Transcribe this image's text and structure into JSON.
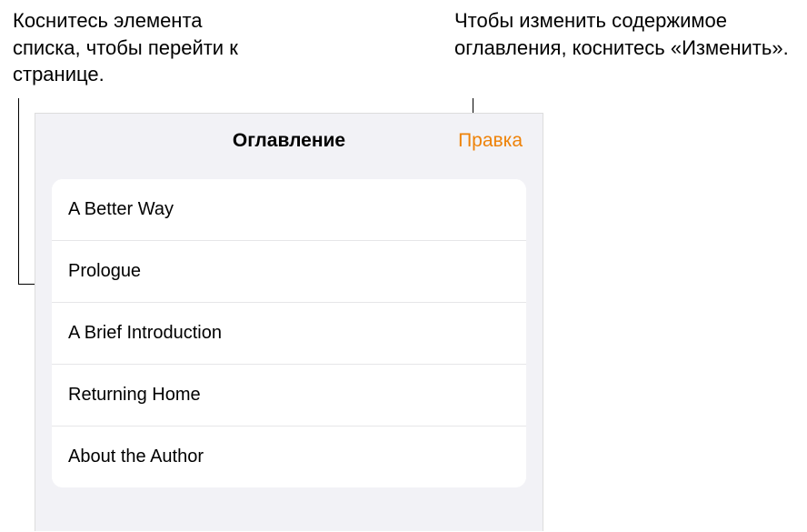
{
  "callouts": {
    "left": "Коснитесь элемента списка, чтобы перейти к странице.",
    "right": "Чтобы изменить содержимое оглавления, коснитесь «Изменить»."
  },
  "panel": {
    "title": "Оглавление",
    "edit_label": "Правка"
  },
  "toc": {
    "items": [
      {
        "label": "A Better Way"
      },
      {
        "label": "Prologue"
      },
      {
        "label": "A Brief Introduction"
      },
      {
        "label": "Returning Home"
      },
      {
        "label": "About the Author"
      }
    ]
  },
  "colors": {
    "accent": "#ee8208",
    "panel_bg": "#f2f2f6",
    "divider": "#e6e6e8"
  }
}
